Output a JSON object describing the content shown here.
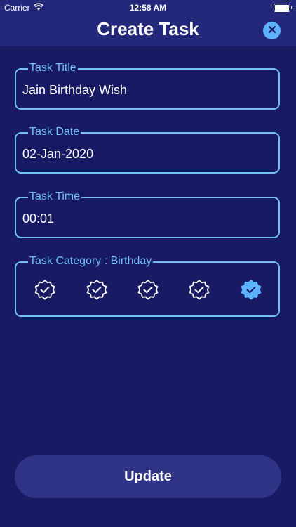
{
  "status_bar": {
    "carrier": "Carrier",
    "time": "12:58 AM",
    "wifi_icon": "wifi-icon",
    "battery_icon": "battery-icon"
  },
  "nav": {
    "title": "Create Task",
    "close_icon": "close-icon"
  },
  "form": {
    "task_title": {
      "label": "Task Title",
      "value": "Jain Birthday Wish"
    },
    "task_date": {
      "label": "Task Date",
      "value": "02-Jan-2020"
    },
    "task_time": {
      "label": "Task Time",
      "value": "00:01"
    },
    "task_category": {
      "label": "Task Category : Birthday",
      "options": [
        {
          "icon": "verified-badge-icon",
          "selected": false
        },
        {
          "icon": "verified-badge-icon",
          "selected": false
        },
        {
          "icon": "verified-badge-icon",
          "selected": false
        },
        {
          "icon": "verified-badge-icon",
          "selected": false
        },
        {
          "icon": "verified-badge-icon",
          "selected": true
        }
      ]
    }
  },
  "update_button": {
    "label": "Update"
  },
  "colors": {
    "background": "#181a63",
    "header": "#24287a",
    "accent": "#6fc0f5",
    "selected": "#5fb2ff",
    "button": "#2f3486"
  }
}
